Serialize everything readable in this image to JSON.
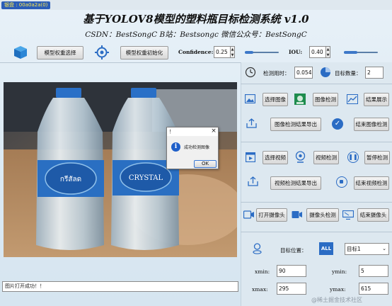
{
  "window": {
    "title_tag": "银盘 : 00a0a2a(0)"
  },
  "header": {
    "title": "基于YOLOV8模型的塑料瓶目标检测系统 v1.0",
    "subtitle": "CSDN：BestSongC   B站：Bestsongc   微信公众号：BestSongC"
  },
  "toolbar": {
    "model_select_label": "模型权重选择",
    "model_init_label": "模型权重初始化",
    "confidence_label": "Confidence:",
    "confidence_value": "0.25",
    "confidence_level": 0.25,
    "iou_label": "IOU:",
    "iou_value": "0.40",
    "iou_level": 0.4
  },
  "stats": {
    "time_label": "检测用时：",
    "time_value": "0.054",
    "count_label": "目标数量：",
    "count_value": "2"
  },
  "image_controls": {
    "select_label": "选择图像",
    "detect_label": "图像检测",
    "show_label": "结果展示",
    "export_label": "图像检测结果导出",
    "end_label": "结束图像检测"
  },
  "video_controls": {
    "select_label": "选择视频",
    "detect_label": "视频检测",
    "pause_label": "暂停检测",
    "export_label": "视频检测结果导出",
    "end_label": "结束视频检测"
  },
  "camera_controls": {
    "open_label": "打开摄像头",
    "detect_label": "摄像头检测",
    "end_label": "结束摄像头"
  },
  "target": {
    "position_label": "目标位置：",
    "all_badge": "ALL",
    "selected_target": "目标1",
    "xmin_label": "xmin:",
    "xmin_value": "90",
    "ymin_label": "ymin:",
    "ymin_value": "5",
    "xmax_label": "xmax:",
    "xmax_value": "295",
    "ymax_label": "ymax:",
    "ymax_value": "615"
  },
  "dialog": {
    "title": "！",
    "close": "×",
    "message": "成功检测图像",
    "ok_label": "OK"
  },
  "image": {
    "bottle_label_left": "กรีสัลด",
    "bottle_label_right": "CRYSTAL"
  },
  "status": {
    "message": "图片打开成功！！"
  },
  "watermark": "@稀土掘金技术社区",
  "colors": {
    "accent": "#2b6cc4",
    "slider": "#3d78c8"
  }
}
